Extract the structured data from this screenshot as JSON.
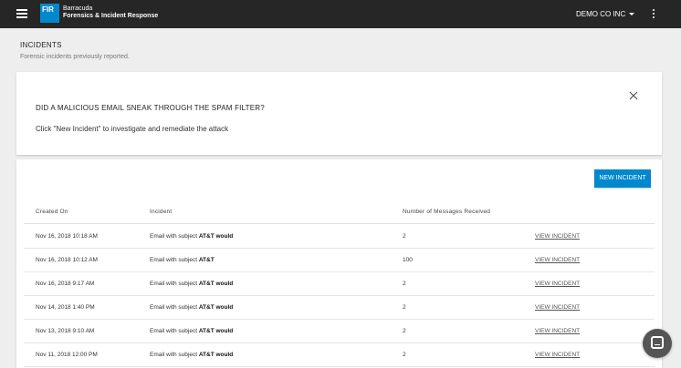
{
  "header": {
    "logo_mark": "FIR",
    "brand_line1": "Barracuda",
    "brand_line2": "Forensics & Incident Response",
    "org_name": "DEMO CO INC"
  },
  "page": {
    "title": "INCIDENTS",
    "subtitle": "Forensic incidents previously reported."
  },
  "alert": {
    "title": "DID A MALICIOUS EMAIL SNEAK THROUGH THE SPAM FILTER?",
    "body": "Click \"New Incident\" to investigate and remediate the attack"
  },
  "table": {
    "new_button": "NEW INCIDENT",
    "columns": [
      "Created On",
      "Incident",
      "Number of Messages Received",
      ""
    ],
    "rows": [
      {
        "created": "Nov 16, 2018 10:18 AM",
        "incident_prefix": "Email with subject ",
        "incident_subject": "AT&T would",
        "messages": "2",
        "action": "VIEW INCIDENT"
      },
      {
        "created": "Nov 16, 2018 10:12 AM",
        "incident_prefix": "Email with subject ",
        "incident_subject": "AT&T",
        "messages": "100",
        "action": "VIEW INCIDENT"
      },
      {
        "created": "Nov 16, 2018 9:17 AM",
        "incident_prefix": "Email with subject ",
        "incident_subject": "AT&T would",
        "messages": "2",
        "action": "VIEW INCIDENT"
      },
      {
        "created": "Nov 14, 2018 1:40 PM",
        "incident_prefix": "Email with subject ",
        "incident_subject": "AT&T would",
        "messages": "2",
        "action": "VIEW INCIDENT"
      },
      {
        "created": "Nov 13, 2018 9:10 AM",
        "incident_prefix": "Email with subject ",
        "incident_subject": "AT&T would",
        "messages": "2",
        "action": "VIEW INCIDENT"
      },
      {
        "created": "Nov 11, 2018 12:00 PM",
        "incident_prefix": "Email with subject ",
        "incident_subject": "AT&T would",
        "messages": "2",
        "action": "VIEW INCIDENT"
      }
    ]
  },
  "icons": {
    "menu": "hamburger-menu-icon",
    "org_dropdown": "caret-down-icon",
    "more": "kebab-menu-icon",
    "close": "close-icon",
    "chat": "chat-icon"
  },
  "colors": {
    "topbar": "#262626",
    "accent": "#0088ce",
    "background": "#eeeeee"
  }
}
